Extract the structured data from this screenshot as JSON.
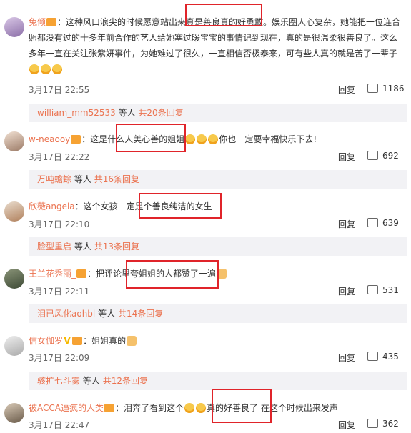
{
  "comments": [
    {
      "username": "兔倾",
      "text": "这种风口浪尖的时候愿意站出来真是善良真的好勇敢。娱乐圈人心复杂，她能把一位连合照都没有过的十多年前合作的艺人给她塞过暖宝宝的事情记到现在，真的是很温柔很善良了。这么多年一直在关注张紫妍事件，为她难过了很久，一直相信否极泰来，可有些人真的就是苦了一辈子",
      "date": "3月17日 22:55",
      "reply": "回复",
      "likes": "1186",
      "sub": {
        "names": "william_mm52533",
        "suffix": "等人",
        "more": "共20条回复"
      }
    },
    {
      "username": "w-neaooy",
      "text_a": "这是什么人美心善的姐姐",
      "text_b": "你也一定要幸福快乐下去!",
      "date": "3月17日 22:22",
      "reply": "回复",
      "likes": "692",
      "sub": {
        "names": "万吨蟾蜍",
        "suffix": "等人",
        "more": "共16条回复"
      }
    },
    {
      "username": "欣薇angela",
      "text": "这个女孩一定是个善良纯洁的女生",
      "date": "3月17日 22:10",
      "reply": "回复",
      "likes": "639",
      "sub": {
        "names": "脸型重启",
        "suffix": "等人",
        "more": "共13条回复"
      }
    },
    {
      "username": "王兰花秀丽_",
      "text": "把评论里夸姐姐的人都赞了一遍",
      "date": "3月17日 22:11",
      "reply": "回复",
      "likes": "531",
      "sub": {
        "names": "泪已风化aohbl",
        "suffix": "等人",
        "more": "共14条回复"
      }
    },
    {
      "username": "信女伽罗",
      "text": "姐姐真的",
      "date": "3月17日 22:09",
      "reply": "回复",
      "likes": "435",
      "sub": {
        "names": "骇扩七斗雾",
        "suffix": "等人",
        "more": "共12条回复"
      }
    },
    {
      "username": "被ACCA逼疯的人类",
      "text_a": "泪奔了看到这个",
      "text_b": "真的好善良了 在这个时候出来发声",
      "date": "3月17日 22:47",
      "reply": "回复",
      "likes": "362"
    }
  ],
  "colors": {
    "username": "#eb7350",
    "highlight_box": "#e0242a",
    "subbar_bg": "#f2f2f5"
  }
}
